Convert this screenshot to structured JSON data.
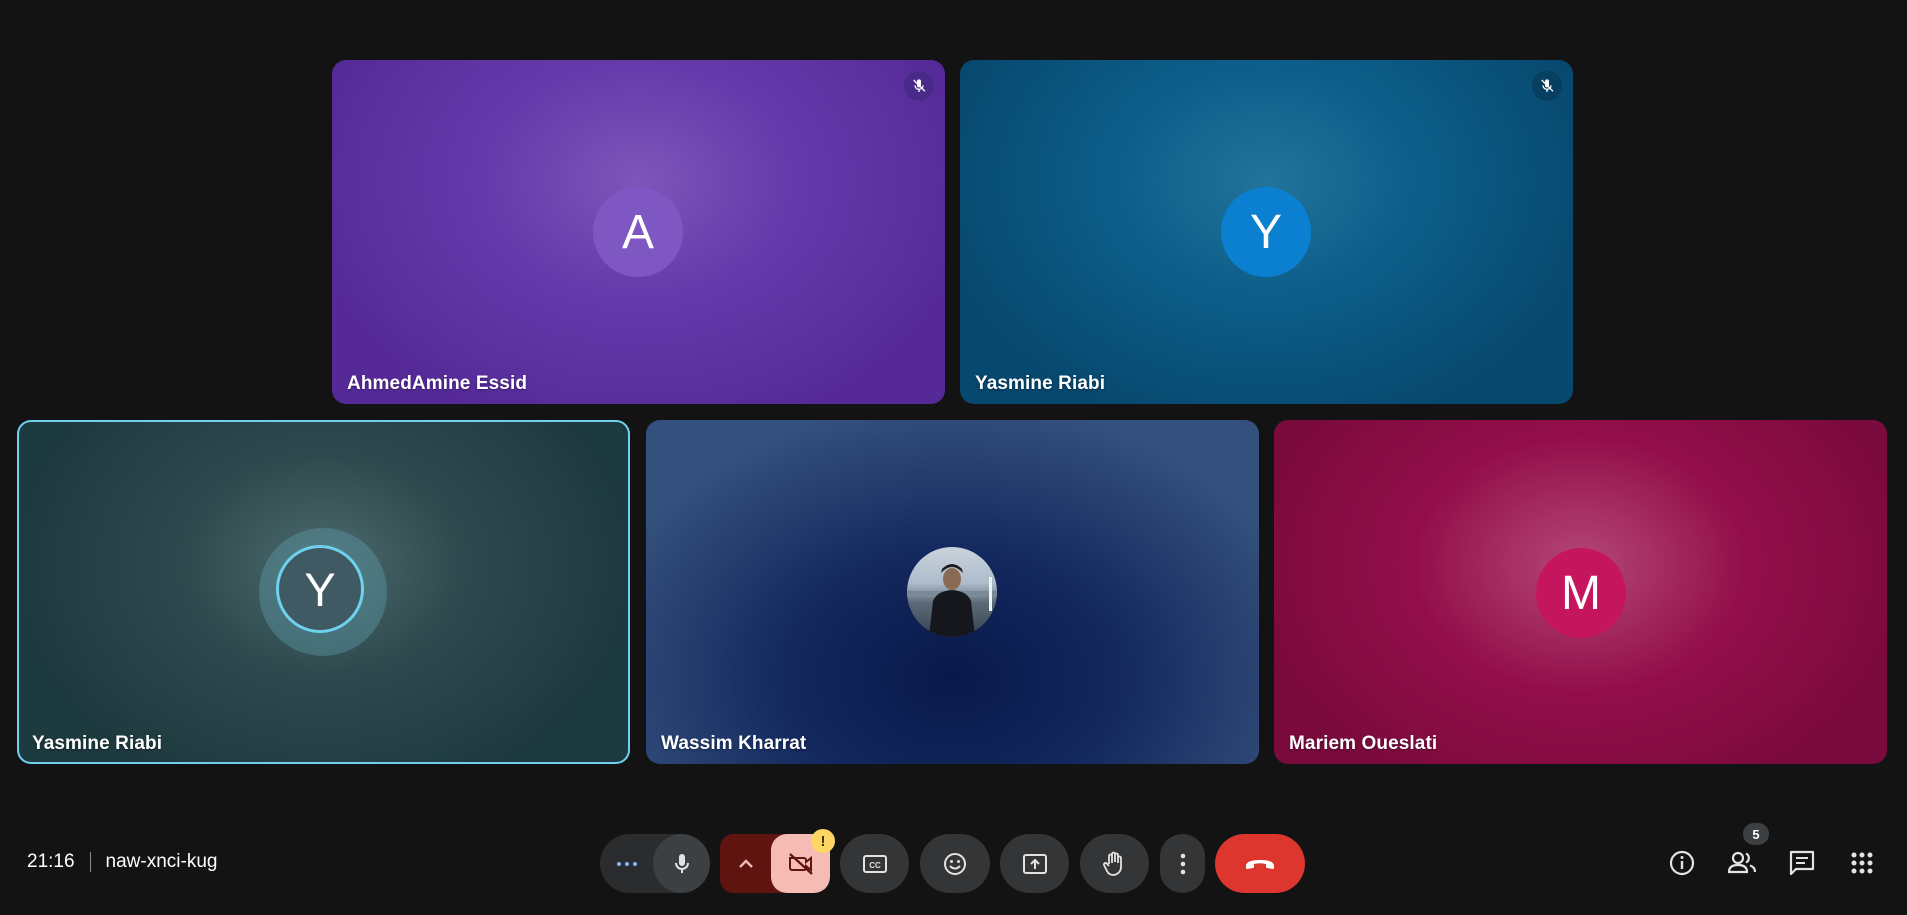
{
  "participants": [
    {
      "name": "AhmedAmine Essid",
      "initial": "A",
      "avatar_color": "#7e57c2",
      "muted": true
    },
    {
      "name": "Yasmine Riabi",
      "initial": "Y",
      "avatar_color": "#0b80d0",
      "muted": true
    },
    {
      "name": "Yasmine Riabi",
      "initial": "Y",
      "avatar_color": "#3f5a62",
      "speaking": true
    },
    {
      "name": "Wassim Kharrat",
      "has_photo": true
    },
    {
      "name": "Mariem Oueslati",
      "initial": "M",
      "avatar_color": "#c5165d"
    }
  ],
  "meeting": {
    "time": "21:16",
    "code": "naw-xnci-kug"
  },
  "controls": {
    "camera_warning": "!",
    "people_count": "5"
  },
  "colors": {
    "end_call": "#dc362e",
    "camera_off": "#f4bcb5",
    "speaking_ring": "#6fd0ef"
  }
}
